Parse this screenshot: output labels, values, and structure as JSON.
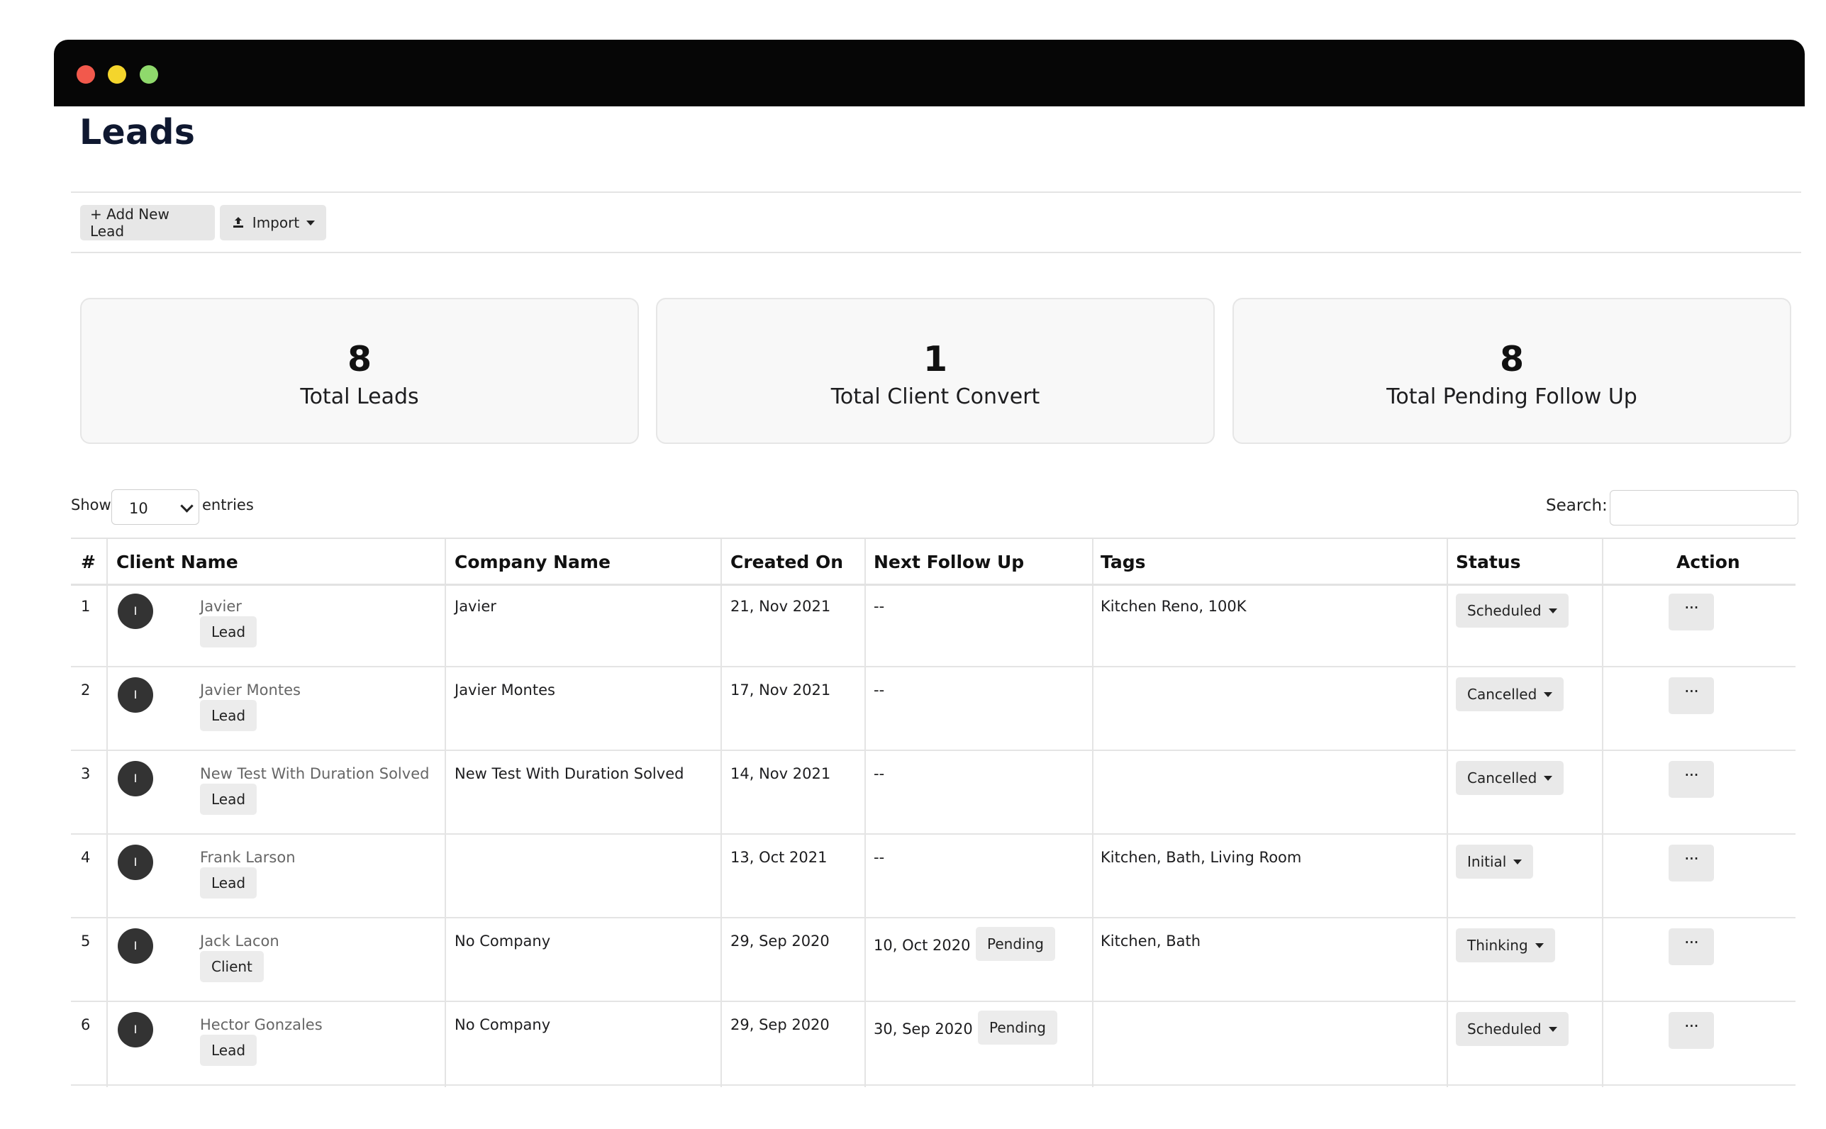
{
  "window": {
    "controls": [
      "close",
      "minimize",
      "maximize"
    ]
  },
  "page": {
    "title": "Leads"
  },
  "toolbar": {
    "add_label": "+ Add New Lead",
    "import_label": "Import",
    "import_icon": "upload-icon"
  },
  "stats": [
    {
      "value": "8",
      "label": "Total Leads"
    },
    {
      "value": "1",
      "label": "Total Client Convert"
    },
    {
      "value": "8",
      "label": "Total Pending Follow Up"
    }
  ],
  "table_controls": {
    "show_label": "Show",
    "entries_value": "10",
    "entries_label": "entries",
    "search_label": "Search:",
    "search_value": ""
  },
  "table": {
    "headers": [
      "#",
      "Client Name",
      "Company Name",
      "Created On",
      "Next Follow Up",
      "Tags",
      "Status",
      "Action"
    ],
    "rows": [
      {
        "num": "1",
        "avatar": "I",
        "name": "Javier",
        "type": "Lead",
        "company": "Javier",
        "created": "21, Nov 2021",
        "follow_up": "--",
        "follow_status": "",
        "tags": "Kitchen Reno, 100K",
        "status": "Scheduled",
        "action": "···"
      },
      {
        "num": "2",
        "avatar": "I",
        "name": "Javier Montes",
        "type": "Lead",
        "company": "Javier Montes",
        "created": "17, Nov 2021",
        "follow_up": "--",
        "follow_status": "",
        "tags": "",
        "status": "Cancelled",
        "action": "···"
      },
      {
        "num": "3",
        "avatar": "I",
        "name": "New Test With Duration Solved",
        "type": "Lead",
        "company": "New Test With Duration Solved",
        "created": "14, Nov 2021",
        "follow_up": "--",
        "follow_status": "",
        "tags": "",
        "status": "Cancelled",
        "action": "···"
      },
      {
        "num": "4",
        "avatar": "I",
        "name": "Frank Larson",
        "type": "Lead",
        "company": "",
        "created": "13, Oct 2021",
        "follow_up": "--",
        "follow_status": "",
        "tags": "Kitchen, Bath, Living Room",
        "status": "Initial",
        "action": "···"
      },
      {
        "num": "5",
        "avatar": "I",
        "name": "Jack Lacon",
        "type": "Client",
        "company": "No Company",
        "created": "29, Sep 2020",
        "follow_up": "10, Oct 2020",
        "follow_status": "Pending",
        "tags": "Kitchen, Bath",
        "status": "Thinking",
        "action": "···"
      },
      {
        "num": "6",
        "avatar": "I",
        "name": "Hector Gonzales",
        "type": "Lead",
        "company": "No Company",
        "created": "29, Sep 2020",
        "follow_up": "30, Sep 2020",
        "follow_status": "Pending",
        "tags": "",
        "status": "Scheduled",
        "action": "···"
      }
    ]
  }
}
